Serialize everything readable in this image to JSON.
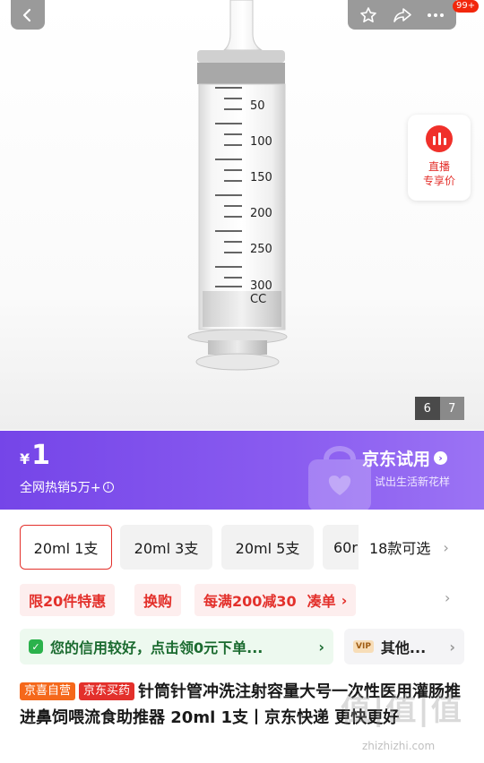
{
  "header": {
    "back_icon": "chevron-left-icon",
    "actions": [
      "star-icon",
      "share-icon",
      "more-icon"
    ],
    "message_badge": "99+"
  },
  "gallery": {
    "current": "6",
    "total": "7",
    "scale_labels": [
      "50",
      "100",
      "150",
      "200",
      "250",
      "300",
      "CC"
    ]
  },
  "live": {
    "line1": "直播",
    "line2": "专享价"
  },
  "promo": {
    "currency": "¥",
    "price": "1",
    "hot_sales": "全网热销5万+",
    "trial_title": "京东试用",
    "trial_subtitle": "试出生活新花样",
    "colors": {
      "banner": "#7f50ec",
      "accent": "#e3302b"
    }
  },
  "sku": {
    "options": [
      "20ml 1支",
      "20ml 3支",
      "20ml 5支",
      "60r"
    ],
    "selected_index": 0,
    "more_label": "18款可选"
  },
  "tags": [
    "限20件特惠",
    "换购",
    "每满200减30",
    "凑单"
  ],
  "credit": {
    "text": "您的信用较好，点击领0元下单...",
    "vip_badge": "VIP",
    "other_text": "其他..."
  },
  "product": {
    "label_jx": "京喜自营",
    "label_jd": "京东买药",
    "title": "针筒针管冲洗注射容量大号一次性医用灌肠推进鼻饲喂流食助推器 20ml 1支丨京东快递 更快更好"
  },
  "watermark": {
    "mark": "值|值|值",
    "url": "zhizhizhi.com"
  }
}
